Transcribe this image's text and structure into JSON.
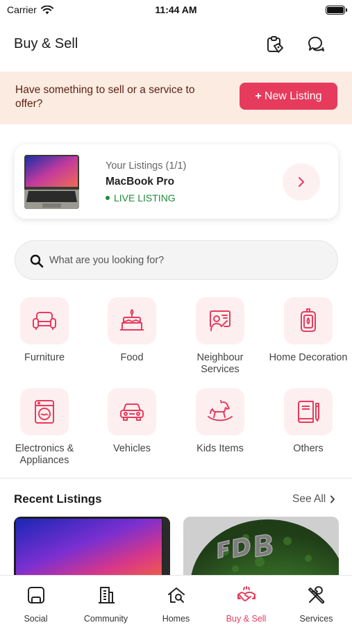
{
  "status_bar": {
    "carrier": "Carrier",
    "time": "11:44 AM"
  },
  "header": {
    "title": "Buy & Sell",
    "icons": [
      "saved-listings-icon",
      "chat-icon"
    ]
  },
  "banner": {
    "text": "Have something to sell or a service to offer?",
    "button_label": "New Listing",
    "button_prefix": "+"
  },
  "my_listings": {
    "count_label": "Your Listings (1/1)",
    "item_name": "MacBook Pro",
    "status": "LIVE LISTING"
  },
  "search": {
    "placeholder": "What are you looking for?"
  },
  "categories": [
    {
      "label": "Furniture",
      "icon": "sofa-icon"
    },
    {
      "label": "Food",
      "icon": "cake-icon"
    },
    {
      "label": "Neighbour Services",
      "icon": "service-board-icon"
    },
    {
      "label": "Home Decoration",
      "icon": "lantern-icon"
    },
    {
      "label": "Electronics & Appliances",
      "icon": "washing-machine-icon"
    },
    {
      "label": "Vehicles",
      "icon": "car-icon"
    },
    {
      "label": "Kids Items",
      "icon": "rocking-horse-icon"
    },
    {
      "label": "Others",
      "icon": "notebook-pen-icon"
    }
  ],
  "recent": {
    "title": "Recent Listings",
    "see_all": "See All"
  },
  "tabs": [
    {
      "label": "Social",
      "icon": "social-icon"
    },
    {
      "label": "Community",
      "icon": "building-icon"
    },
    {
      "label": "Homes",
      "icon": "home-search-icon"
    },
    {
      "label": "Buy & Sell",
      "icon": "handshake-icon",
      "active": true
    },
    {
      "label": "Services",
      "icon": "tools-icon"
    }
  ],
  "colors": {
    "accent": "#e63b5c",
    "banner_bg": "#fcebe0",
    "live_green": "#1f8a3b"
  }
}
